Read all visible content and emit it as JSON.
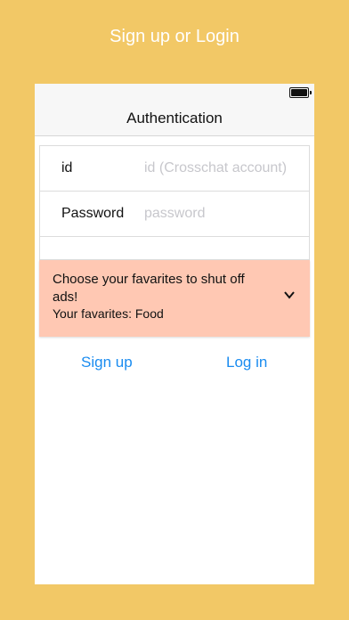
{
  "banner": {
    "title": "Sign up or Login"
  },
  "navbar": {
    "title": "Authentication"
  },
  "form": {
    "id_label": "id",
    "id_placeholder": "id (Crosschat account)",
    "password_label": "Password",
    "password_placeholder": "password"
  },
  "favorites": {
    "prompt": "Choose your favarites to shut off ads!",
    "current": "Your favarites: Food",
    "icon": "chevron-down-icon"
  },
  "actions": {
    "signup_label": "Sign up",
    "login_label": "Log in"
  },
  "colors": {
    "background": "#f2c866",
    "favorites_bg": "#ffc8b3",
    "link": "#1a8cf0"
  }
}
